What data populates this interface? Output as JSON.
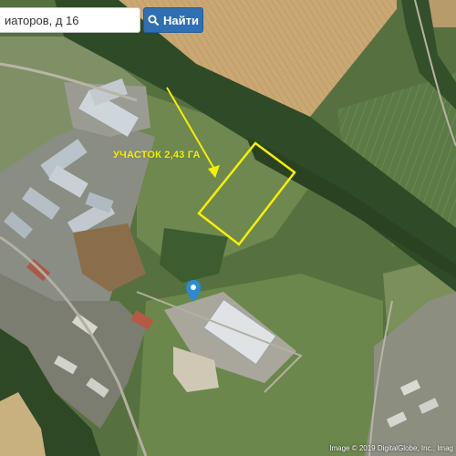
{
  "search": {
    "value": "иаторов, д 16",
    "button_label": "Найти",
    "button_icon": "search-icon"
  },
  "map": {
    "type": "satellite",
    "colors": {
      "field": "#c9a874",
      "vegetation": "#4f6b3c",
      "forest": "#2f4a26",
      "highlight": "#f4f100",
      "marker": "#2b8ad6"
    }
  },
  "annotation": {
    "label": "УЧАСТОК 2,43 ГА"
  },
  "marker": {
    "icon": "map-pin-icon"
  },
  "attribution": "Image © 2019 DigitalGlobe, Inc., Imag"
}
